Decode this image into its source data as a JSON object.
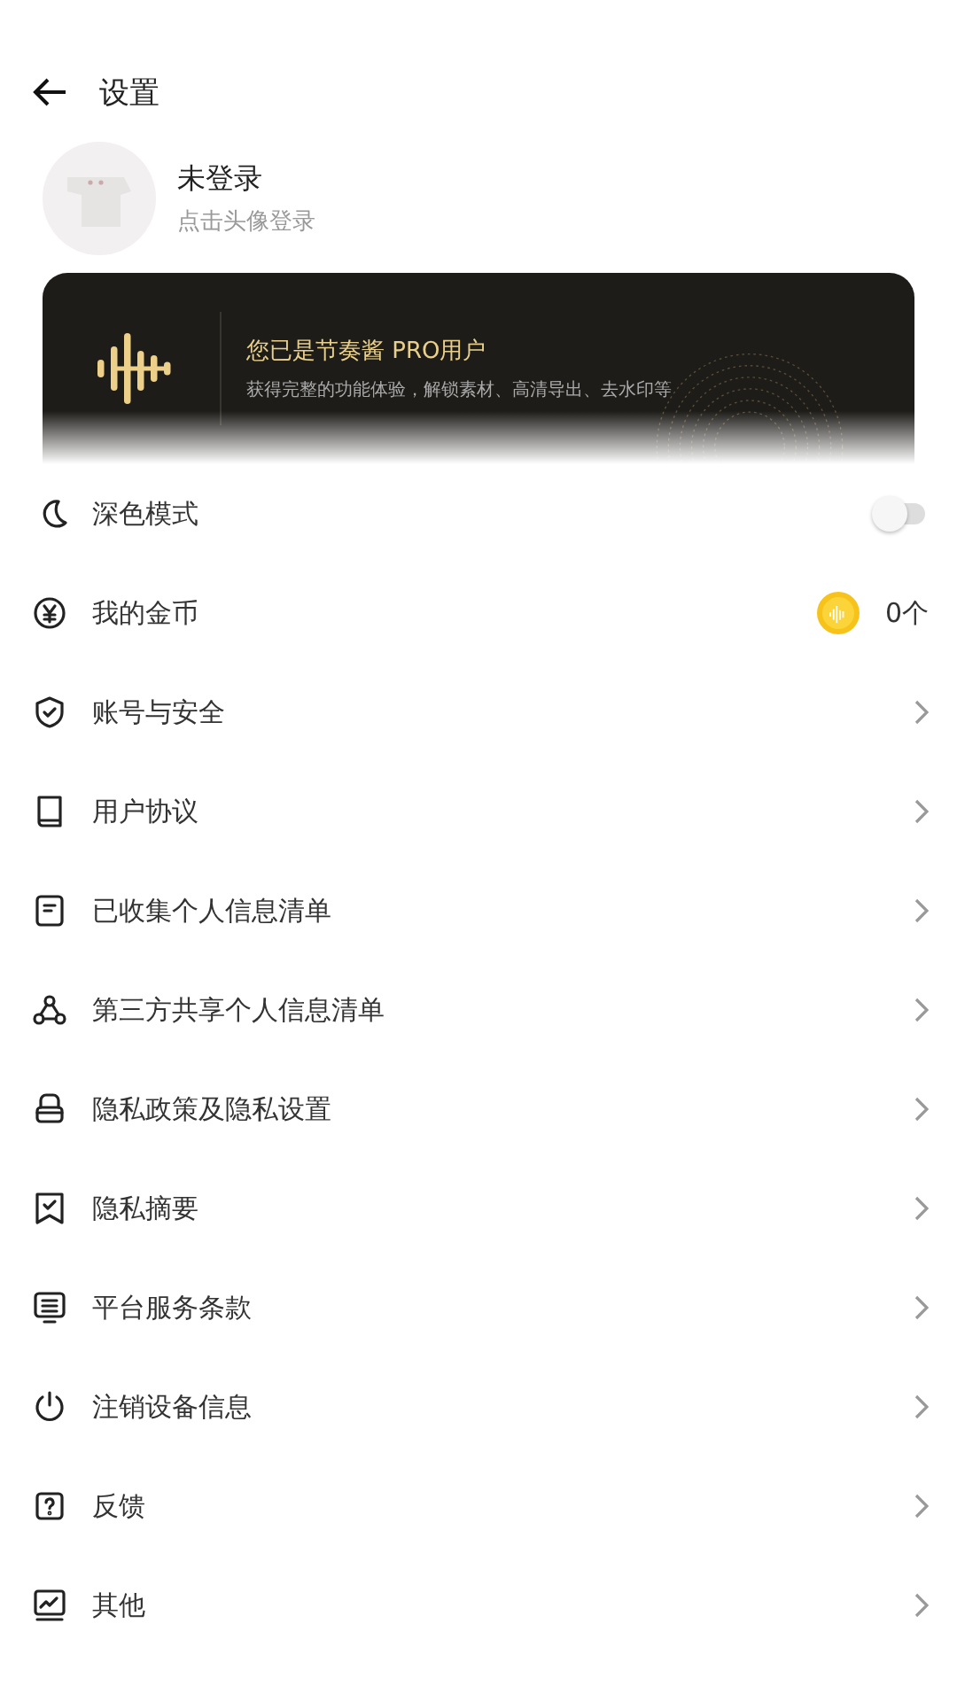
{
  "header": {
    "title": "设置"
  },
  "profile": {
    "name": "未登录",
    "hint": "点击头像登录"
  },
  "banner": {
    "title": "您已是节奏酱 PRO用户",
    "subtitle": "获得完整的功能体验，解锁素材、高清导出、去水印等"
  },
  "items": [
    {
      "kind": "toggle",
      "label": "深色模式",
      "on": false
    },
    {
      "kind": "coins",
      "label": "我的金币",
      "value": "0个"
    },
    {
      "kind": "link",
      "label": "账号与安全"
    },
    {
      "kind": "link",
      "label": "用户协议"
    },
    {
      "kind": "link",
      "label": "已收集个人信息清单"
    },
    {
      "kind": "link",
      "label": "第三方共享个人信息清单"
    },
    {
      "kind": "link",
      "label": "隐私政策及隐私设置"
    },
    {
      "kind": "link",
      "label": "隐私摘要"
    },
    {
      "kind": "link",
      "label": "平台服务条款"
    },
    {
      "kind": "link",
      "label": "注销设备信息"
    },
    {
      "kind": "link",
      "label": "反馈"
    },
    {
      "kind": "link",
      "label": "其他"
    }
  ]
}
